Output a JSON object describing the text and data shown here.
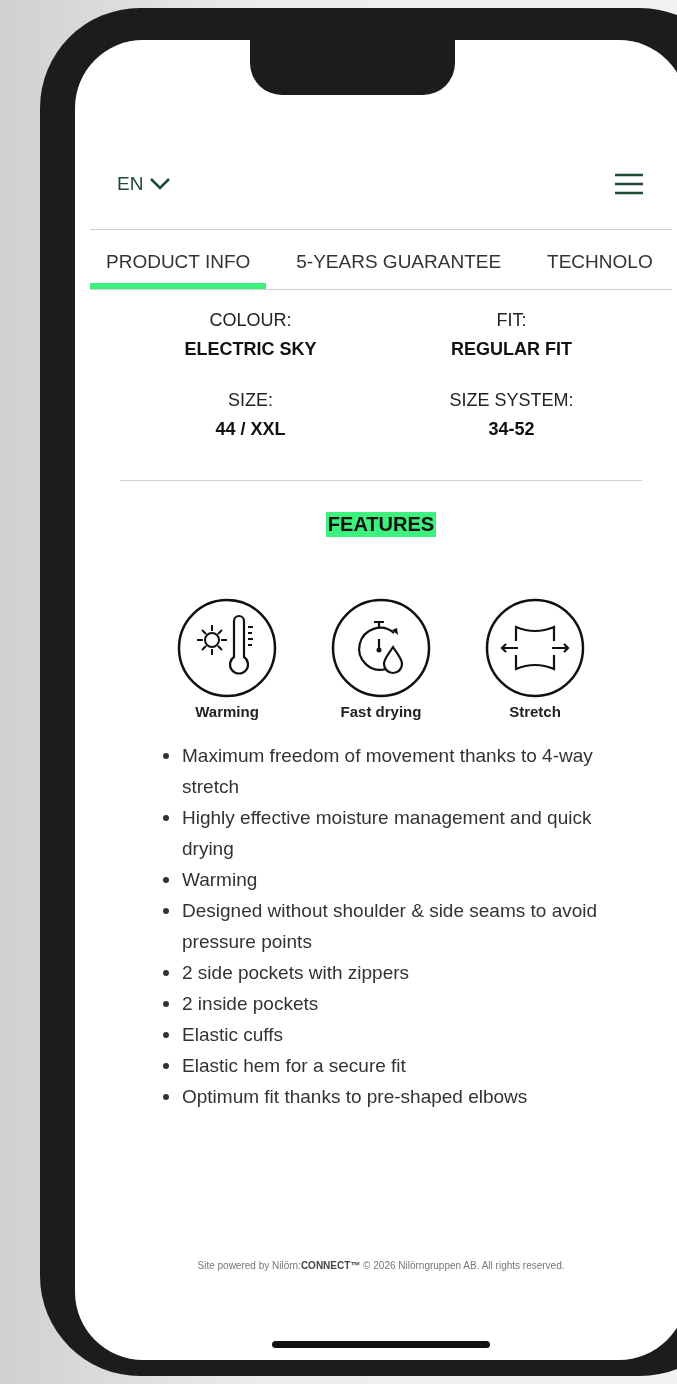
{
  "header": {
    "language": "EN"
  },
  "tabs": [
    {
      "label": "PRODUCT INFO",
      "selected": true
    },
    {
      "label": "5-YEARS GUARANTEE",
      "selected": false
    },
    {
      "label": "TECHNOLO",
      "selected": false
    }
  ],
  "specs": [
    {
      "label": "COLOUR:",
      "value": "ELECTRIC SKY"
    },
    {
      "label": "FIT:",
      "value": "REGULAR FIT"
    },
    {
      "label": "SIZE:",
      "value": "44 / XXL"
    },
    {
      "label": "SIZE SYSTEM:",
      "value": "34-52"
    }
  ],
  "features": {
    "title": "FEATURES",
    "icons": [
      {
        "kind": "thermo",
        "label": "Warming"
      },
      {
        "kind": "timer",
        "label": "Fast drying"
      },
      {
        "kind": "stretch",
        "label": "Stretch"
      }
    ],
    "bullets": [
      "Maximum freedom of movement thanks to 4-way stretch",
      "Highly effective moisture management and quick drying",
      "Warming",
      "Designed without shoulder & side seams to avoid pressure points",
      "2 side pockets with zippers",
      "2 inside pockets",
      "Elastic cuffs",
      "Elastic hem for a secure fit",
      "Optimum fit thanks to pre-shaped elbows"
    ]
  },
  "footer": "Site powered by Nilörn:**CONNECT™** © 2026 Nilörngruppen AB. All rights reserved."
}
